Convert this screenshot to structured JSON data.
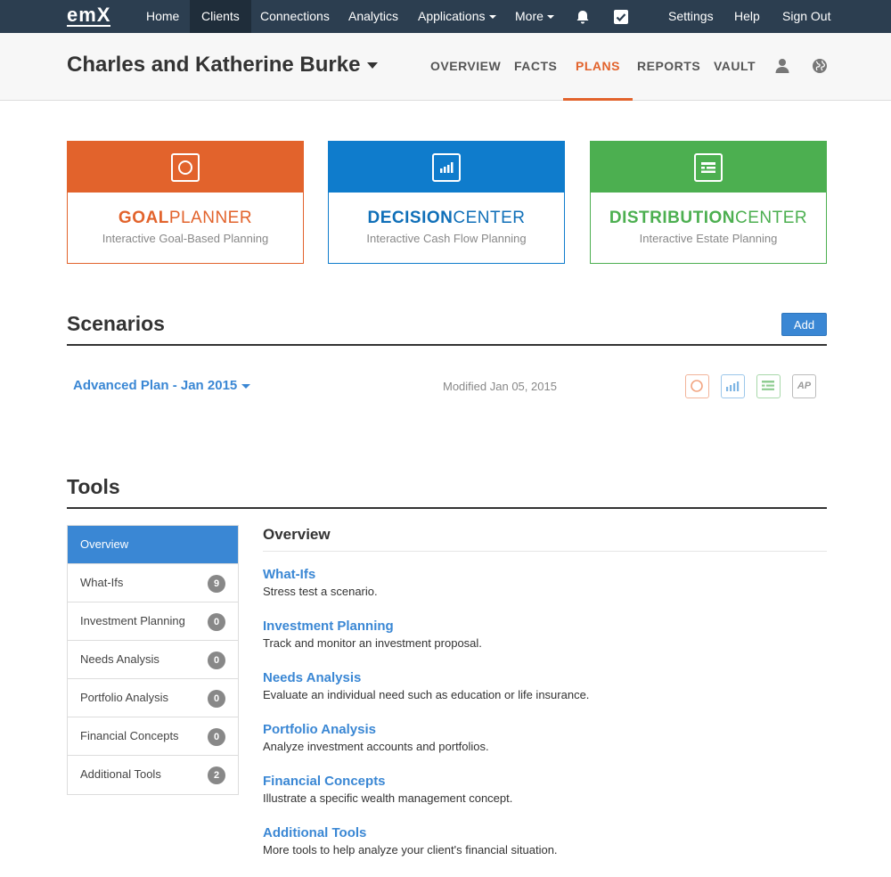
{
  "nav": {
    "logo": "emX",
    "items": [
      {
        "label": "Home"
      },
      {
        "label": "Clients"
      },
      {
        "label": "Connections"
      },
      {
        "label": "Analytics"
      },
      {
        "label": "Applications"
      },
      {
        "label": "More"
      },
      {
        "label": "Settings"
      },
      {
        "label": "Help"
      },
      {
        "label": "Sign Out"
      }
    ],
    "active": "Clients",
    "icons": [
      "bell-icon",
      "checkbox-icon"
    ]
  },
  "client": {
    "name": "Charles and Katherine Burke",
    "tabs": [
      {
        "label": "OVERVIEW"
      },
      {
        "label": "FACTS"
      },
      {
        "label": "PLANS"
      },
      {
        "label": "REPORTS"
      },
      {
        "label": "VAULT"
      }
    ],
    "active_tab": "PLANS",
    "icons": [
      "user-icon",
      "globe-icon"
    ]
  },
  "cards": [
    {
      "bold": "GOAL",
      "light": "PLANNER",
      "subtitle": "Interactive Goal-Based Planning",
      "color": "#e2632c",
      "icon": "circle-icon"
    },
    {
      "bold": "DECISION",
      "light": "CENTER",
      "subtitle": "Interactive Cash Flow Planning",
      "color": "#0f7ccc",
      "icon": "bar-chart-icon"
    },
    {
      "bold": "DISTRIBUTION",
      "light": "CENTER",
      "subtitle": "Interactive Estate Planning",
      "color": "#4caf50",
      "icon": "list-icon"
    }
  ],
  "scenarios": {
    "title": "Scenarios",
    "add_label": "Add",
    "items": [
      {
        "name": "Advanced Plan - Jan 2015",
        "modified": "Modified Jan 05, 2015",
        "ap_label": "AP"
      }
    ]
  },
  "tools": {
    "title": "Tools",
    "items": [
      {
        "label": "Overview",
        "count": ""
      },
      {
        "label": "What-Ifs",
        "count": "9"
      },
      {
        "label": "Investment Planning",
        "count": "0"
      },
      {
        "label": "Needs Analysis",
        "count": "0"
      },
      {
        "label": "Portfolio Analysis",
        "count": "0"
      },
      {
        "label": "Financial Concepts",
        "count": "0"
      },
      {
        "label": "Additional Tools",
        "count": "2"
      }
    ],
    "overview": {
      "title": "Overview",
      "entries": [
        {
          "title": "What-Ifs",
          "desc": "Stress test a scenario."
        },
        {
          "title": "Investment Planning",
          "desc": "Track and monitor an investment proposal."
        },
        {
          "title": "Needs Analysis",
          "desc": "Evaluate an individual need such as education or life insurance."
        },
        {
          "title": "Portfolio Analysis",
          "desc": "Analyze investment accounts and portfolios."
        },
        {
          "title": "Financial Concepts",
          "desc": "Illustrate a specific wealth management concept."
        },
        {
          "title": "Additional Tools",
          "desc": "More tools to help analyze your client's financial situation."
        }
      ]
    }
  }
}
